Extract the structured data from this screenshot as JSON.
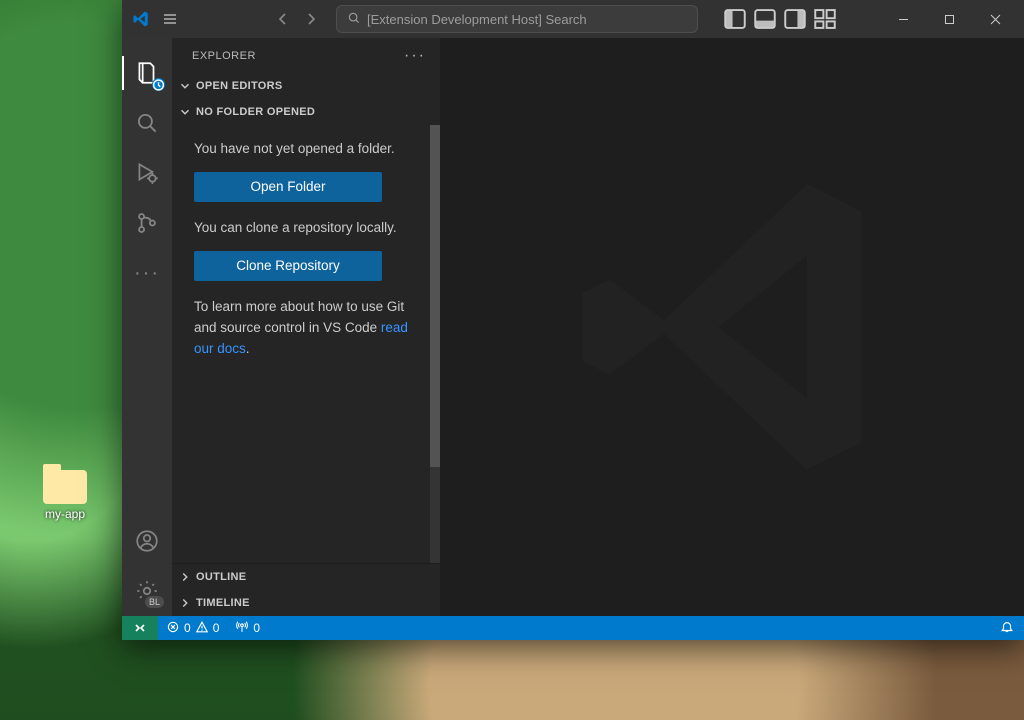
{
  "desktop": {
    "folder_label": "my-app"
  },
  "titlebar": {
    "command_center_text": "[Extension Development Host] Search"
  },
  "sidebar": {
    "title": "EXPLORER",
    "sections": {
      "open_editors": "OPEN EDITORS",
      "no_folder": "NO FOLDER OPENED",
      "outline": "OUTLINE",
      "timeline": "TIMELINE"
    },
    "body": {
      "no_folder_msg": "You have not yet opened a folder.",
      "open_folder_btn": "Open Folder",
      "clone_msg": "You can clone a repository locally.",
      "clone_btn": "Clone Repository",
      "learn_prefix": "To learn more about how to use Git and source control in VS Code ",
      "learn_link": "read our docs",
      "learn_suffix": "."
    }
  },
  "statusbar": {
    "errors": "0",
    "warnings": "0",
    "ports": "0"
  }
}
